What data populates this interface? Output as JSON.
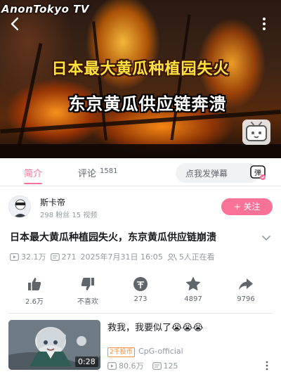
{
  "video": {
    "watermark": "AnonTokyo TV",
    "subtitle_line1": "日本最大黄瓜种植园失火",
    "subtitle_line2": "东京黄瓜供应链奔溃"
  },
  "tabs": {
    "intro_label": "简介",
    "comments_label": "评论",
    "comments_count": "1581",
    "danmaku_placeholder": "点我发弹幕",
    "danmaku_button": "弹"
  },
  "uploader": {
    "name": "斯卡帝",
    "stats": "298 粉丝  15 视频",
    "follow_label": "+ 关注"
  },
  "title": "日本最大黄瓜种植园失火，东京黄瓜供应链崩溃",
  "meta": {
    "views": "32.1万",
    "danmaku_count": "271",
    "date": "2025年7月31日 16:05",
    "watching": "5人正在看"
  },
  "actions": {
    "like": "2.6万",
    "dislike": "不喜欢",
    "coin": "273",
    "favorite": "4897",
    "share": "9796"
  },
  "related": {
    "title": "救我，我要似了😭😭😭",
    "duration": "0:28",
    "coin_badge": "2千投币",
    "author": "CpG-official",
    "views": "80.6万",
    "danmaku_count": "125"
  },
  "colors": {
    "accent": "#fb7299",
    "muted": "#9499a0",
    "coin_badge": "#f88d3b"
  }
}
